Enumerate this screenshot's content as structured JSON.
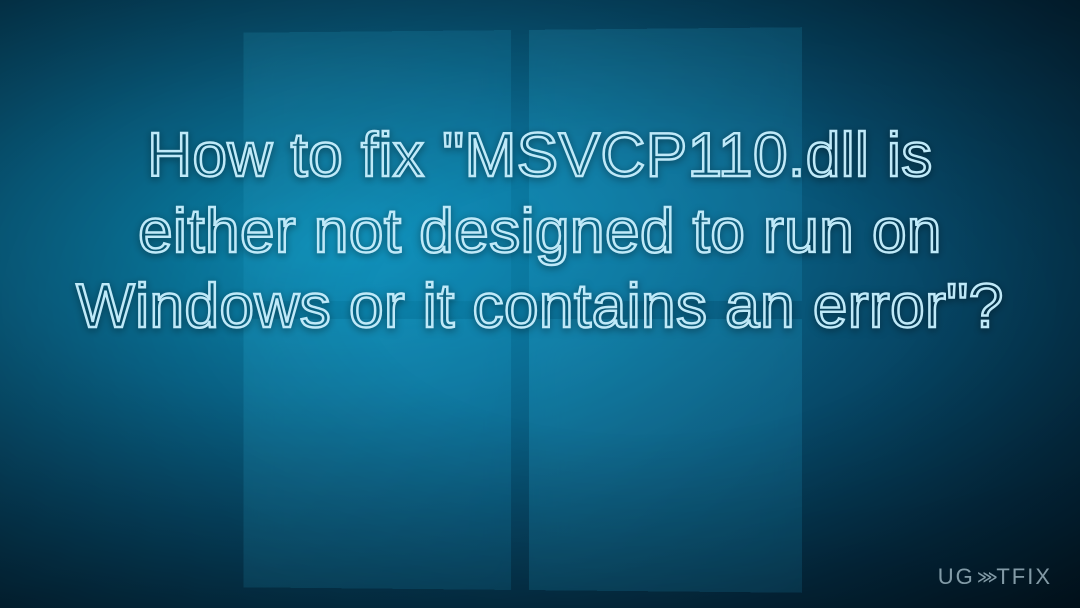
{
  "headline": "How to fix \"MSVCP110.dll is either not designed to run on Windows or it contains an error\"?",
  "watermark": {
    "prefix": "UG",
    "arrows": "⋙",
    "suffix": "TFIX"
  },
  "palette": {
    "text_outline": "#bfe9f8",
    "bg_center": "#0b8fb8",
    "bg_edge": "#021623",
    "logo_tint": "#1796c6"
  }
}
